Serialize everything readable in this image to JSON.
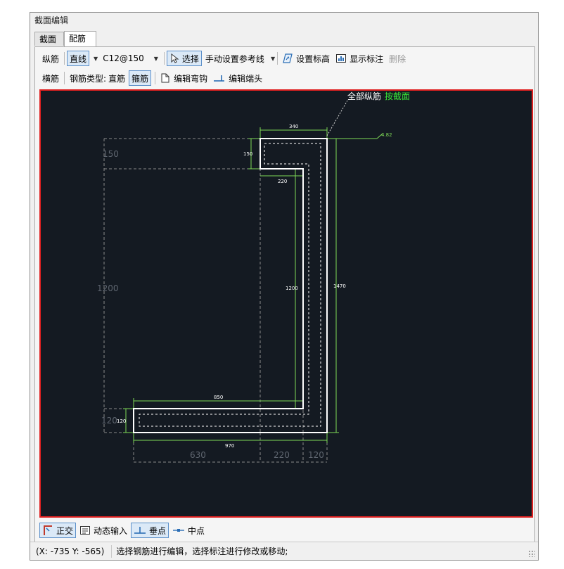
{
  "window": {
    "title": "截面编辑"
  },
  "tabs": [
    {
      "label": "截面",
      "active": false
    },
    {
      "label": "配筋",
      "active": true
    }
  ],
  "toolbar1": {
    "longitudinal_label": "纵筋",
    "line_mode": "直线",
    "rebar_spec": "C12@150",
    "select_label": "选择",
    "manual_ref_label": "手动设置参考线",
    "set_elevation_label": "设置标高",
    "show_annotation_label": "显示标注",
    "delete_label": "删除"
  },
  "toolbar2": {
    "transverse_label": "横筋",
    "rebar_type_label": "钢筋类型:",
    "straight_label": "直筋",
    "stirrup_label": "箍筋",
    "edit_hook_label": "编辑弯钩",
    "edit_end_label": "编辑端头"
  },
  "drawing": {
    "all_longitudinal_label": "全部纵筋",
    "by_section_label": "按截面",
    "elevation_mark": "4.82",
    "dims": {
      "top_width": "340",
      "top_flange_height": "150",
      "inner_top": "220",
      "web_inner_height": "1200",
      "total_height": "1470",
      "bottom_inner_width": "850",
      "bottom_flange_height": "120",
      "bottom_total_width": "970"
    },
    "grid_labels": {
      "left_top": "150",
      "left_middle": "1200",
      "left_bottom": "120",
      "bottom_left": "630",
      "bottom_middle": "220",
      "bottom_right": "120"
    },
    "colors": {
      "background": "#141a22",
      "dimension": "#7ed957",
      "outline": "#ffffff",
      "grid": "#8a8a8a",
      "frame": "#e02020",
      "highlight": "#39e639"
    }
  },
  "snap_bar": {
    "ortho_label": "正交",
    "dynamic_input_label": "动态输入",
    "perpendicular_label": "垂点",
    "midpoint_label": "中点"
  },
  "status": {
    "coords": "(X: -735 Y: -565)",
    "message": "选择钢筋进行编辑，选择标注进行修改或移动;"
  }
}
